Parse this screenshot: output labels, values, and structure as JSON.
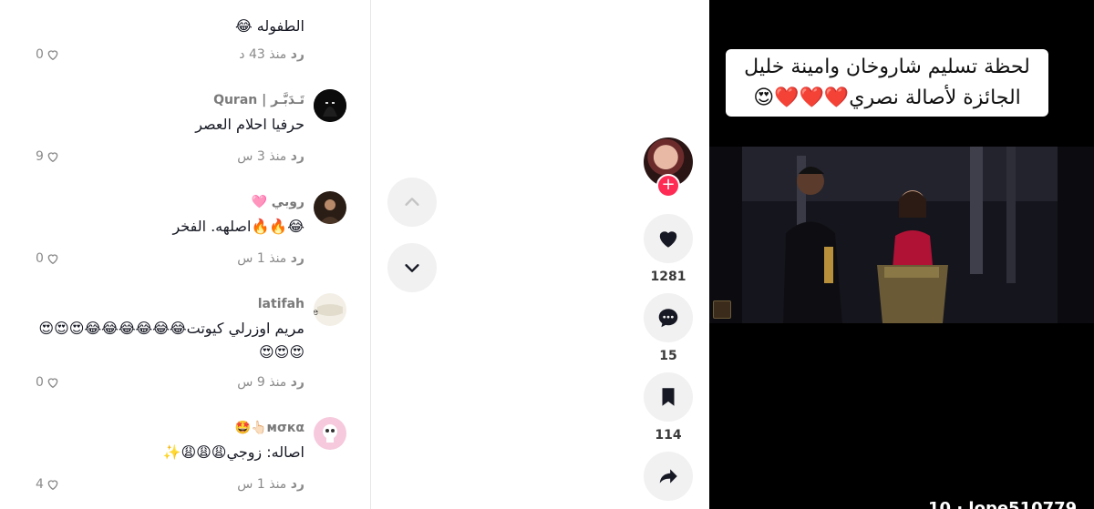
{
  "comments": [
    {
      "username": "",
      "text": "الطفوله 😂",
      "time": "منذ 43 د",
      "reply_label": "رد",
      "likes": "0"
    },
    {
      "username": "تَـدَبَّـر | Quran",
      "text": "حرفيا احلام العصر",
      "time": "منذ 3 س",
      "reply_label": "رد",
      "likes": "9"
    },
    {
      "username": "روبي 🩷",
      "text": "😂🔥🔥اصلهه. الفخر",
      "time": "منذ 1 س",
      "reply_label": "رد",
      "likes": "0"
    },
    {
      "username": "latifah",
      "text": "مريم اوزرلي كيوتت😂😂😂😂😂😂😍😍😍😍😍😍",
      "time": "منذ 9 س",
      "reply_label": "رد",
      "likes": "0"
    },
    {
      "username": "мσкα👆🏻🤩",
      "text": "اصاله: زوجي😩😩😩✨",
      "time": "منذ 1 س",
      "reply_label": "رد",
      "likes": "4"
    }
  ],
  "actions": {
    "likes": "1281",
    "comments": "15",
    "saves": "114"
  },
  "video": {
    "caption_line1": "لحظة تسليم شاروخان وامينة خليل",
    "caption_line2": "الجائزة لأصالة نصري❤️❤️❤️😍",
    "bottom_text": "10 ·   lope510779"
  },
  "colors": {
    "follow": "#fe2c55",
    "button_bg": "#f1f1f2",
    "text": "#161823",
    "muted": "#8a8a8a"
  }
}
